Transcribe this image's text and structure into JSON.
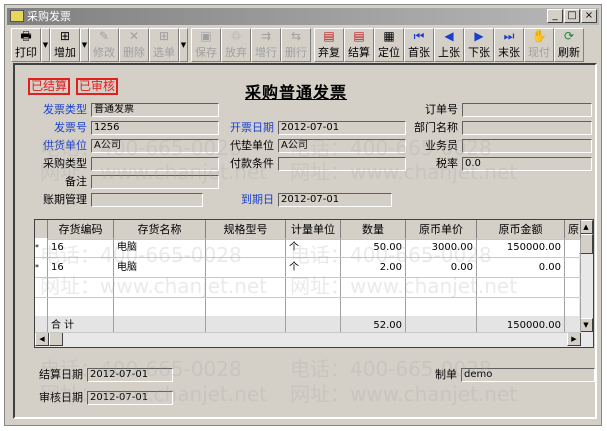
{
  "window": {
    "title": "采购发票",
    "min": "_",
    "max": "□",
    "close": "×"
  },
  "toolbar": [
    {
      "label": "打印",
      "icon": "printer-icon",
      "glyph": "🖶",
      "enabled": true,
      "dropdown": true
    },
    {
      "label": "增加",
      "icon": "add-doc-icon",
      "glyph": "⊞",
      "enabled": true,
      "dropdown": true
    },
    {
      "label": "修改",
      "icon": "edit-icon",
      "glyph": "✎",
      "enabled": false
    },
    {
      "label": "删除",
      "icon": "delete-icon",
      "glyph": "✕",
      "enabled": false
    },
    {
      "label": "选单",
      "icon": "select-doc-icon",
      "glyph": "⊞",
      "enabled": false,
      "dropdown": true
    },
    {
      "label": "保存",
      "icon": "save-icon",
      "glyph": "▣",
      "enabled": false
    },
    {
      "label": "放弃",
      "icon": "discard-icon",
      "glyph": "♲",
      "enabled": false
    },
    {
      "label": "增行",
      "icon": "add-row-icon",
      "glyph": "⇉",
      "enabled": false
    },
    {
      "label": "删行",
      "icon": "delete-row-icon",
      "glyph": "⇆",
      "enabled": false
    },
    {
      "label": "弃复",
      "icon": "unsettle-icon",
      "glyph": "▤",
      "enabled": true
    },
    {
      "label": "结算",
      "icon": "settle-icon",
      "glyph": "▤",
      "enabled": true
    },
    {
      "label": "定位",
      "icon": "locate-icon",
      "glyph": "▦",
      "enabled": true
    },
    {
      "label": "首张",
      "icon": "first-icon",
      "glyph": "⏮",
      "enabled": true
    },
    {
      "label": "上张",
      "icon": "prev-icon",
      "glyph": "◀",
      "enabled": true
    },
    {
      "label": "下张",
      "icon": "next-icon",
      "glyph": "▶",
      "enabled": true
    },
    {
      "label": "末张",
      "icon": "last-icon",
      "glyph": "⏭",
      "enabled": true
    },
    {
      "label": "现付",
      "icon": "cash-pay-icon",
      "glyph": "✋",
      "enabled": false
    },
    {
      "label": "刷新",
      "icon": "refresh-icon",
      "glyph": "⟳",
      "enabled": true
    }
  ],
  "stamps": [
    "已结算",
    "已审核"
  ],
  "page_title": "采购普通发票",
  "header": {
    "invoice_type": {
      "label": "发票类型",
      "value": "普通发票"
    },
    "invoice_no": {
      "label": "发票号",
      "value": "1256"
    },
    "supplier": {
      "label": "供货单位",
      "value": "A公司"
    },
    "purchase_type": {
      "label": "采购类型",
      "value": ""
    },
    "remark": {
      "label": "备注",
      "value": ""
    },
    "credit_mgmt": {
      "label": "账期管理",
      "value": ""
    },
    "invoice_date": {
      "label": "开票日期",
      "value": "2012-07-01"
    },
    "advance_unit": {
      "label": "代垫单位",
      "value": "A公司"
    },
    "payment_terms": {
      "label": "付款条件",
      "value": ""
    },
    "due_date": {
      "label": "到期日",
      "value": "2012-07-01"
    },
    "order_no": {
      "label": "订单号",
      "value": ""
    },
    "department": {
      "label": "部门名称",
      "value": ""
    },
    "salesperson": {
      "label": "业务员",
      "value": ""
    },
    "tax_rate": {
      "label": "税率",
      "value": "0.0"
    }
  },
  "grid": {
    "columns": [
      "存货编码",
      "存货名称",
      "规格型号",
      "计量单位",
      "数量",
      "原币单价",
      "原币金额",
      "原"
    ],
    "rows": [
      [
        "16",
        "电脑",
        "",
        "个",
        "50.00",
        "3000.00",
        "150000.00",
        ""
      ],
      [
        "16",
        "电脑",
        "",
        "个",
        "2.00",
        "0.00",
        "0.00",
        ""
      ]
    ],
    "total": {
      "label": "合  计",
      "qty": "52.00",
      "amount": "150000.00"
    }
  },
  "footer": {
    "settle_date": {
      "label": "结算日期",
      "value": "2012-07-01"
    },
    "audit_date": {
      "label": "审核日期",
      "value": "2012-07-01"
    },
    "maker": {
      "label": "制单",
      "value": "demo"
    }
  },
  "watermark": {
    "phone": "电话：400-665-0028",
    "site": "网址：www.chanjet.net"
  },
  "colors": {
    "label_blue": "#1a3fd0",
    "stamp_red": "#e02020"
  }
}
